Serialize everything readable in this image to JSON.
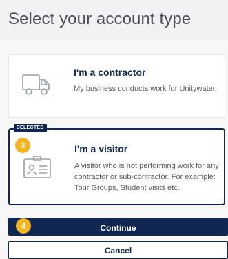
{
  "header": {
    "title": "Select your account type"
  },
  "options": [
    {
      "title": "I'm a contractor",
      "description": "My business conducts work for Unitywater.",
      "icon": "truck-icon",
      "selected": false
    },
    {
      "title": "I'm a visitor",
      "description": "A visitor who is not performing work for any contractor or sub-contractor. For example: Tour Groups, Student visits etc.",
      "icon": "id-card-icon",
      "selected": true,
      "badge": "SELECTED"
    }
  ],
  "markers": {
    "step3": "3",
    "step4": "4"
  },
  "actions": {
    "continue_label": "Continue",
    "cancel_label": "Cancel"
  },
  "colors": {
    "brand_navy": "#0f2751",
    "marker_amber": "#f4b41a",
    "icon_gray": "#9aa0a8"
  }
}
